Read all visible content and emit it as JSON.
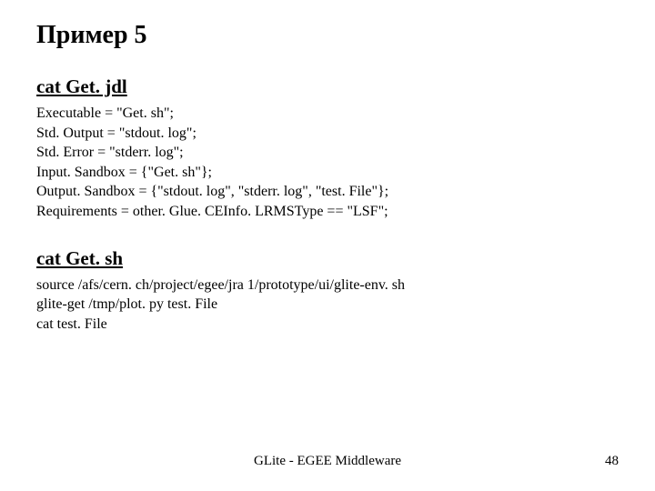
{
  "title": "Пример 5",
  "section1": {
    "heading": "cat Get. jdl",
    "body": "Executable = \"Get. sh\";\nStd. Output = \"stdout. log\";\nStd. Error = \"stderr. log\";\nInput. Sandbox = {\"Get. sh\"};\nOutput. Sandbox = {\"stdout. log\", \"stderr. log\", \"test. File\"};\nRequirements = other. Glue. CEInfo. LRMSType == \"LSF\";"
  },
  "section2": {
    "heading": "cat Get. sh",
    "body": "source /afs/cern. ch/project/egee/jra 1/prototype/ui/glite-env. sh\nglite-get /tmp/plot. py test. File\ncat test. File"
  },
  "footer": {
    "center": "GLite - EGEE Middleware",
    "page": "48"
  }
}
